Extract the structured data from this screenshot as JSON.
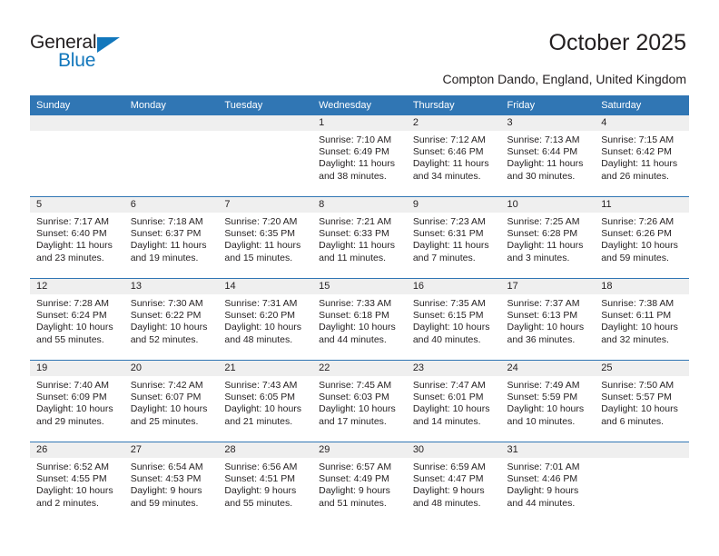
{
  "brand": {
    "name_top": "General",
    "name_bottom": "Blue",
    "color_dark": "#231f20",
    "color_blue": "#1277bc"
  },
  "header": {
    "title": "October 2025",
    "subtitle": "Compton Dando, England, United Kingdom",
    "accent_color": "#3076b4",
    "band_color": "#efefef"
  },
  "weekday_headers": [
    "Sunday",
    "Monday",
    "Tuesday",
    "Wednesday",
    "Thursday",
    "Friday",
    "Saturday"
  ],
  "weeks": [
    [
      {
        "day": "",
        "sunrise": "",
        "sunset": "",
        "daylight": ""
      },
      {
        "day": "",
        "sunrise": "",
        "sunset": "",
        "daylight": ""
      },
      {
        "day": "",
        "sunrise": "",
        "sunset": "",
        "daylight": ""
      },
      {
        "day": "1",
        "sunrise": "Sunrise: 7:10 AM",
        "sunset": "Sunset: 6:49 PM",
        "daylight": "Daylight: 11 hours and 38 minutes."
      },
      {
        "day": "2",
        "sunrise": "Sunrise: 7:12 AM",
        "sunset": "Sunset: 6:46 PM",
        "daylight": "Daylight: 11 hours and 34 minutes."
      },
      {
        "day": "3",
        "sunrise": "Sunrise: 7:13 AM",
        "sunset": "Sunset: 6:44 PM",
        "daylight": "Daylight: 11 hours and 30 minutes."
      },
      {
        "day": "4",
        "sunrise": "Sunrise: 7:15 AM",
        "sunset": "Sunset: 6:42 PM",
        "daylight": "Daylight: 11 hours and 26 minutes."
      }
    ],
    [
      {
        "day": "5",
        "sunrise": "Sunrise: 7:17 AM",
        "sunset": "Sunset: 6:40 PM",
        "daylight": "Daylight: 11 hours and 23 minutes."
      },
      {
        "day": "6",
        "sunrise": "Sunrise: 7:18 AM",
        "sunset": "Sunset: 6:37 PM",
        "daylight": "Daylight: 11 hours and 19 minutes."
      },
      {
        "day": "7",
        "sunrise": "Sunrise: 7:20 AM",
        "sunset": "Sunset: 6:35 PM",
        "daylight": "Daylight: 11 hours and 15 minutes."
      },
      {
        "day": "8",
        "sunrise": "Sunrise: 7:21 AM",
        "sunset": "Sunset: 6:33 PM",
        "daylight": "Daylight: 11 hours and 11 minutes."
      },
      {
        "day": "9",
        "sunrise": "Sunrise: 7:23 AM",
        "sunset": "Sunset: 6:31 PM",
        "daylight": "Daylight: 11 hours and 7 minutes."
      },
      {
        "day": "10",
        "sunrise": "Sunrise: 7:25 AM",
        "sunset": "Sunset: 6:28 PM",
        "daylight": "Daylight: 11 hours and 3 minutes."
      },
      {
        "day": "11",
        "sunrise": "Sunrise: 7:26 AM",
        "sunset": "Sunset: 6:26 PM",
        "daylight": "Daylight: 10 hours and 59 minutes."
      }
    ],
    [
      {
        "day": "12",
        "sunrise": "Sunrise: 7:28 AM",
        "sunset": "Sunset: 6:24 PM",
        "daylight": "Daylight: 10 hours and 55 minutes."
      },
      {
        "day": "13",
        "sunrise": "Sunrise: 7:30 AM",
        "sunset": "Sunset: 6:22 PM",
        "daylight": "Daylight: 10 hours and 52 minutes."
      },
      {
        "day": "14",
        "sunrise": "Sunrise: 7:31 AM",
        "sunset": "Sunset: 6:20 PM",
        "daylight": "Daylight: 10 hours and 48 minutes."
      },
      {
        "day": "15",
        "sunrise": "Sunrise: 7:33 AM",
        "sunset": "Sunset: 6:18 PM",
        "daylight": "Daylight: 10 hours and 44 minutes."
      },
      {
        "day": "16",
        "sunrise": "Sunrise: 7:35 AM",
        "sunset": "Sunset: 6:15 PM",
        "daylight": "Daylight: 10 hours and 40 minutes."
      },
      {
        "day": "17",
        "sunrise": "Sunrise: 7:37 AM",
        "sunset": "Sunset: 6:13 PM",
        "daylight": "Daylight: 10 hours and 36 minutes."
      },
      {
        "day": "18",
        "sunrise": "Sunrise: 7:38 AM",
        "sunset": "Sunset: 6:11 PM",
        "daylight": "Daylight: 10 hours and 32 minutes."
      }
    ],
    [
      {
        "day": "19",
        "sunrise": "Sunrise: 7:40 AM",
        "sunset": "Sunset: 6:09 PM",
        "daylight": "Daylight: 10 hours and 29 minutes."
      },
      {
        "day": "20",
        "sunrise": "Sunrise: 7:42 AM",
        "sunset": "Sunset: 6:07 PM",
        "daylight": "Daylight: 10 hours and 25 minutes."
      },
      {
        "day": "21",
        "sunrise": "Sunrise: 7:43 AM",
        "sunset": "Sunset: 6:05 PM",
        "daylight": "Daylight: 10 hours and 21 minutes."
      },
      {
        "day": "22",
        "sunrise": "Sunrise: 7:45 AM",
        "sunset": "Sunset: 6:03 PM",
        "daylight": "Daylight: 10 hours and 17 minutes."
      },
      {
        "day": "23",
        "sunrise": "Sunrise: 7:47 AM",
        "sunset": "Sunset: 6:01 PM",
        "daylight": "Daylight: 10 hours and 14 minutes."
      },
      {
        "day": "24",
        "sunrise": "Sunrise: 7:49 AM",
        "sunset": "Sunset: 5:59 PM",
        "daylight": "Daylight: 10 hours and 10 minutes."
      },
      {
        "day": "25",
        "sunrise": "Sunrise: 7:50 AM",
        "sunset": "Sunset: 5:57 PM",
        "daylight": "Daylight: 10 hours and 6 minutes."
      }
    ],
    [
      {
        "day": "26",
        "sunrise": "Sunrise: 6:52 AM",
        "sunset": "Sunset: 4:55 PM",
        "daylight": "Daylight: 10 hours and 2 minutes."
      },
      {
        "day": "27",
        "sunrise": "Sunrise: 6:54 AM",
        "sunset": "Sunset: 4:53 PM",
        "daylight": "Daylight: 9 hours and 59 minutes."
      },
      {
        "day": "28",
        "sunrise": "Sunrise: 6:56 AM",
        "sunset": "Sunset: 4:51 PM",
        "daylight": "Daylight: 9 hours and 55 minutes."
      },
      {
        "day": "29",
        "sunrise": "Sunrise: 6:57 AM",
        "sunset": "Sunset: 4:49 PM",
        "daylight": "Daylight: 9 hours and 51 minutes."
      },
      {
        "day": "30",
        "sunrise": "Sunrise: 6:59 AM",
        "sunset": "Sunset: 4:47 PM",
        "daylight": "Daylight: 9 hours and 48 minutes."
      },
      {
        "day": "31",
        "sunrise": "Sunrise: 7:01 AM",
        "sunset": "Sunset: 4:46 PM",
        "daylight": "Daylight: 9 hours and 44 minutes."
      },
      {
        "day": "",
        "sunrise": "",
        "sunset": "",
        "daylight": ""
      }
    ]
  ]
}
